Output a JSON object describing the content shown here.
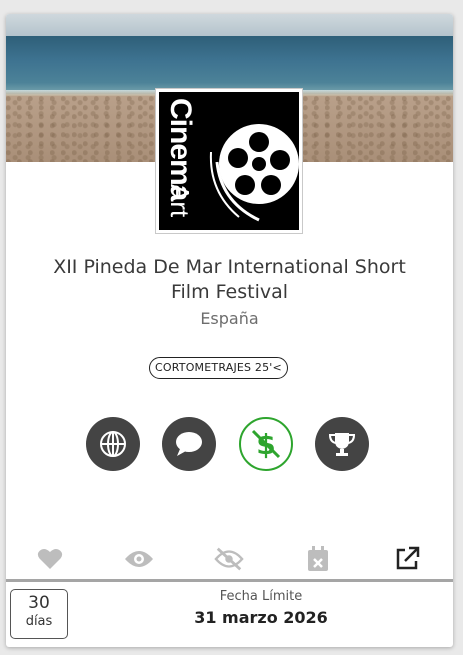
{
  "festival": {
    "logo_text_vertical": "Cinema",
    "logo_text_art": "Art",
    "title_line1": "XII Pineda De Mar International Short",
    "title_line2": "Film Festival",
    "country": "España",
    "category_badge": "CORTOMETRAJES 25'<"
  },
  "feature_icons": [
    {
      "icon": "globe-icon",
      "color": "#444444"
    },
    {
      "icon": "speech-bubble-icon",
      "color": "#444444"
    },
    {
      "icon": "no-fee-dollar-icon",
      "color": "#2ea52e"
    },
    {
      "icon": "trophy-icon",
      "color": "#444444"
    }
  ],
  "action_icons": [
    "heart-icon",
    "eye-icon",
    "eye-slash-icon",
    "calendar-x-icon",
    "external-link-icon"
  ],
  "deadline": {
    "days_count": "30",
    "days_unit": "días",
    "label": "Fecha Límite",
    "date": "31 marzo 2026"
  }
}
